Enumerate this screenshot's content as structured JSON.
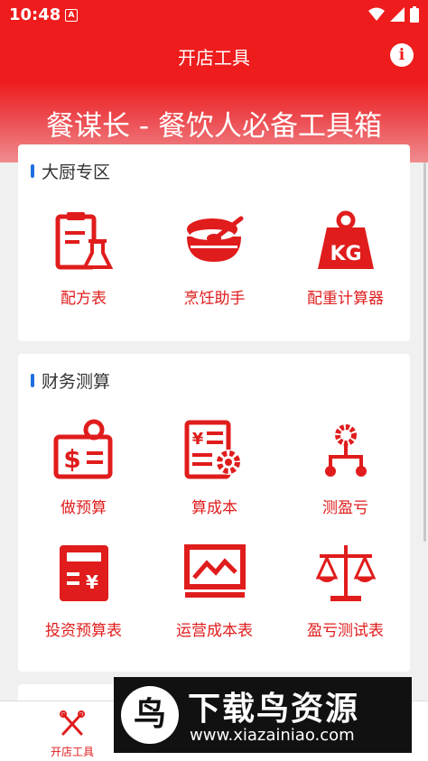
{
  "status": {
    "time": "10:48",
    "a_icon": "A"
  },
  "app_bar": {
    "title": "开店工具",
    "info": "i"
  },
  "banner": {
    "title": "餐谋长 - 餐饮人必备工具箱"
  },
  "sections": [
    {
      "title": "大厨专区",
      "tools": [
        {
          "label": "配方表",
          "icon": "recipe-clipboard-icon"
        },
        {
          "label": "烹饪助手",
          "icon": "cooking-bowl-icon"
        },
        {
          "label": "配重计算器",
          "icon": "kg-weight-icon"
        }
      ]
    },
    {
      "title": "财务测算",
      "tools": [
        {
          "label": "做预算",
          "icon": "budget-money-icon"
        },
        {
          "label": "算成本",
          "icon": "cost-document-icon"
        },
        {
          "label": "测盈亏",
          "icon": "profit-network-icon"
        },
        {
          "label": "投资预算表",
          "icon": "investment-calculator-icon"
        },
        {
          "label": "运营成本表",
          "icon": "operations-chart-icon"
        },
        {
          "label": "盈亏测试表",
          "icon": "balance-scale-icon"
        }
      ]
    }
  ],
  "nav": {
    "tab1": "开店工具"
  },
  "watermark": {
    "title": "下载鸟资源",
    "url": "www.xiazainiao.com",
    "logo": "鸟"
  },
  "colors": {
    "brand": "#ee1c1c",
    "accent_bar": "#1f6fe0"
  }
}
